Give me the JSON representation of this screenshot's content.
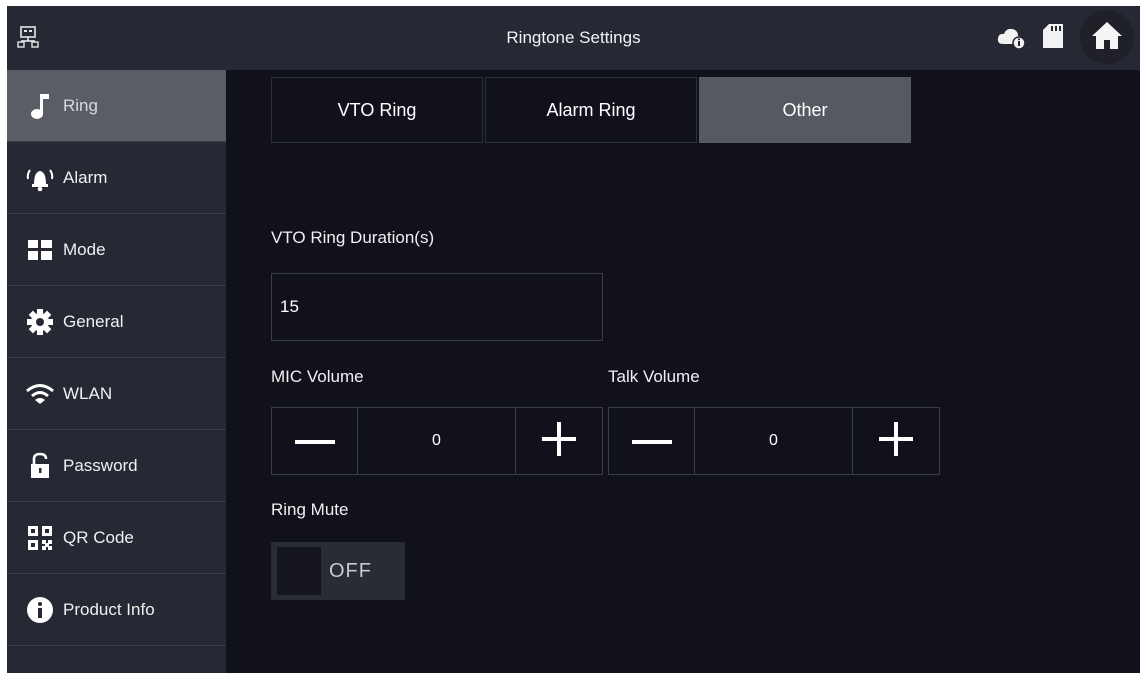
{
  "header": {
    "title": "Ringtone Settings",
    "left_icon": "network-icon",
    "right_icons": [
      "cloud-info-icon",
      "sd-card-icon",
      "home-icon"
    ]
  },
  "sidebar": {
    "items": [
      {
        "label": "Ring",
        "icon": "music-note-icon",
        "active": true
      },
      {
        "label": "Alarm",
        "icon": "alarm-bell-icon",
        "active": false
      },
      {
        "label": "Mode",
        "icon": "mode-grid-icon",
        "active": false
      },
      {
        "label": "General",
        "icon": "gear-icon",
        "active": false
      },
      {
        "label": "WLAN",
        "icon": "wifi-icon",
        "active": false
      },
      {
        "label": "Password",
        "icon": "unlock-icon",
        "active": false
      },
      {
        "label": "QR Code",
        "icon": "qr-code-icon",
        "active": false
      },
      {
        "label": "Product Info",
        "icon": "info-icon",
        "active": false
      }
    ]
  },
  "tabs": [
    {
      "label": "VTO Ring",
      "active": false
    },
    {
      "label": "Alarm Ring",
      "active": false
    },
    {
      "label": "Other",
      "active": true
    }
  ],
  "form": {
    "vto_ring_duration": {
      "label": "VTO Ring Duration(s)",
      "value": "15"
    },
    "mic_volume": {
      "label": "MIC Volume",
      "value": "0"
    },
    "talk_volume": {
      "label": "Talk Volume",
      "value": "0"
    },
    "ring_mute": {
      "label": "Ring Mute",
      "state": "OFF"
    }
  },
  "colors": {
    "background": "#10111a",
    "panel": "#262833",
    "active": "#5a5c66"
  }
}
